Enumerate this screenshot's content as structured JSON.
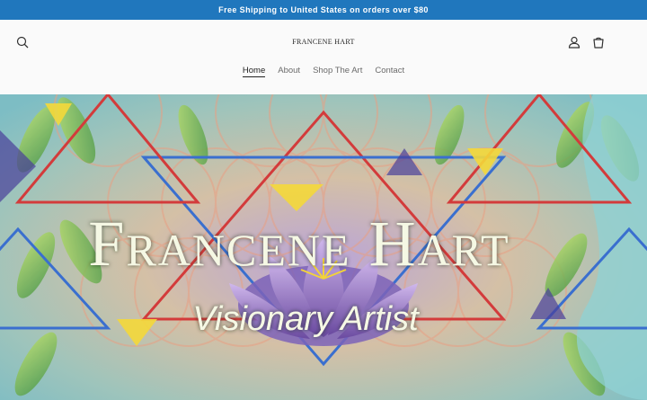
{
  "announcement": {
    "text": "Free Shipping to United States on orders over $80"
  },
  "header": {
    "logo": "FRANCENE HART",
    "icons": {
      "search": "search-icon",
      "account": "user-icon",
      "cart": "cart-icon"
    }
  },
  "nav": {
    "items": [
      {
        "label": "Home",
        "active": true
      },
      {
        "label": "About"
      },
      {
        "label": "Shop The Art"
      },
      {
        "label": "Contact"
      }
    ]
  },
  "hero": {
    "title": "Francene Hart",
    "subtitle": "Visionary Artist"
  },
  "colors": {
    "announcement_bg": "#2077bd",
    "header_bg": "#fafafa",
    "text": "#222222",
    "nav_text": "#6b6b6b"
  }
}
